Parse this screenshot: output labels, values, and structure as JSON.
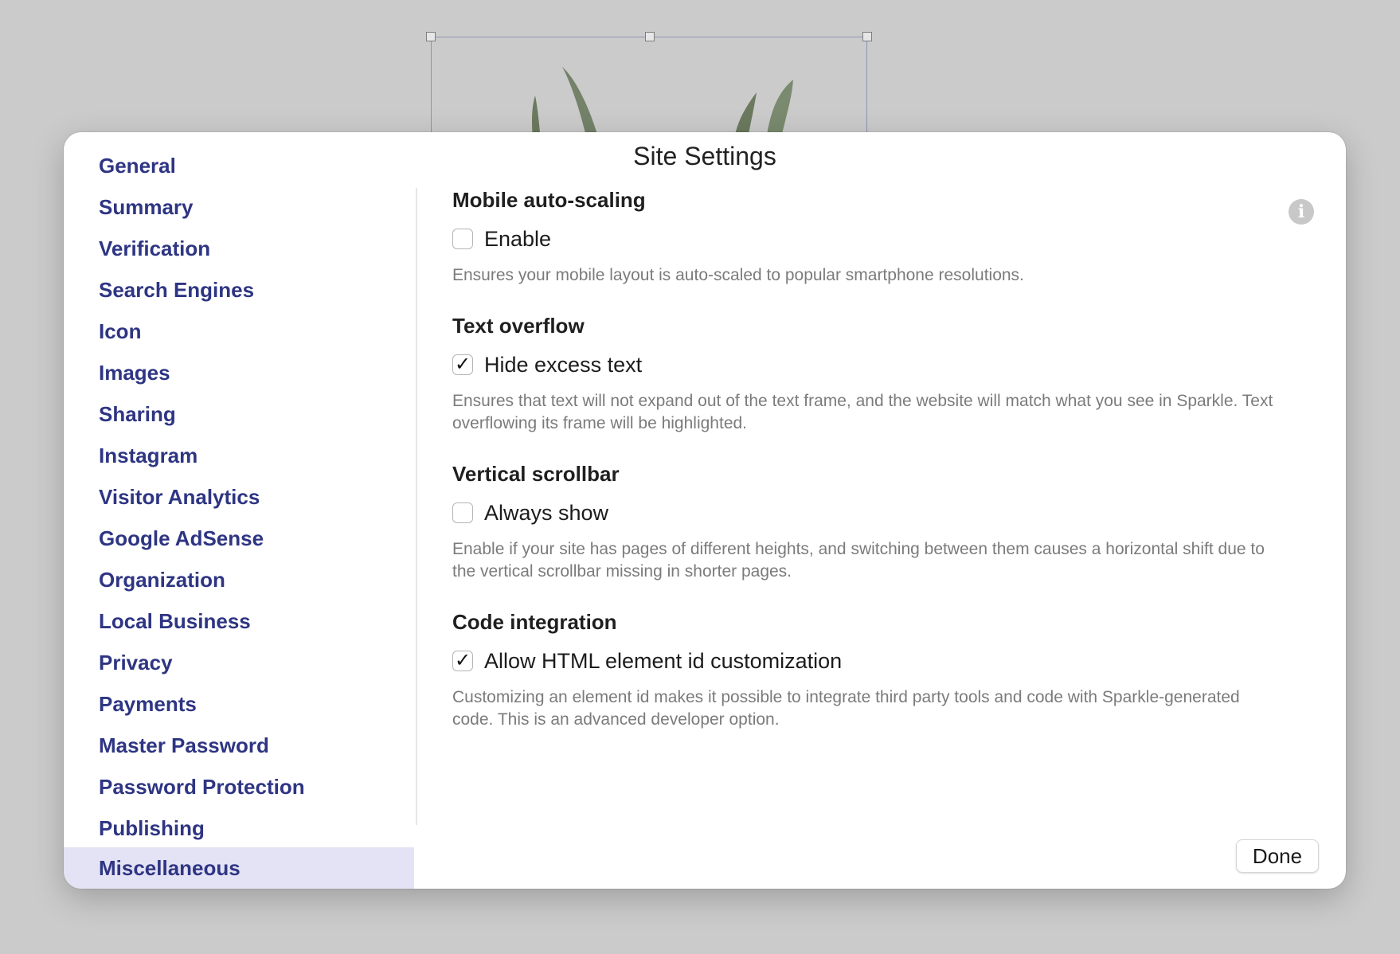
{
  "dialog": {
    "title": "Site Settings"
  },
  "sidebar": {
    "selected_index": 17,
    "items": [
      {
        "label": "General"
      },
      {
        "label": "Summary"
      },
      {
        "label": "Verification"
      },
      {
        "label": "Search Engines"
      },
      {
        "label": "Icon"
      },
      {
        "label": "Images"
      },
      {
        "label": "Sharing"
      },
      {
        "label": "Instagram"
      },
      {
        "label": "Visitor Analytics"
      },
      {
        "label": "Google AdSense"
      },
      {
        "label": "Organization"
      },
      {
        "label": "Local Business"
      },
      {
        "label": "Privacy"
      },
      {
        "label": "Payments"
      },
      {
        "label": "Master Password"
      },
      {
        "label": "Password Protection"
      },
      {
        "label": "Publishing"
      },
      {
        "label": "Miscellaneous"
      }
    ]
  },
  "sections": [
    {
      "heading": "Mobile auto-scaling",
      "checkbox_label": "Enable",
      "checked": false,
      "description": "Ensures your mobile layout is auto-scaled to popular smartphone resolutions."
    },
    {
      "heading": "Text overflow",
      "checkbox_label": "Hide excess text",
      "checked": true,
      "description": "Ensures that text will not expand out of the text frame, and the website will match what you see in Sparkle. Text overflowing its frame will be highlighted."
    },
    {
      "heading": "Vertical scrollbar",
      "checkbox_label": "Always show",
      "checked": false,
      "description": "Enable if your site has pages of different heights, and switching between them causes a horizontal shift due to the vertical scrollbar missing in shorter pages."
    },
    {
      "heading": "Code integration",
      "checkbox_label": "Allow HTML element id customization",
      "checked": true,
      "description": "Customizing an element id makes it possible to integrate third party tools and code with Sparkle-generated code. This is an advanced developer option."
    }
  ],
  "check_glyph": "✓",
  "info_icon": {
    "icon": "info-icon",
    "glyph": "i"
  },
  "done_button": {
    "label": "Done"
  },
  "colors": {
    "sidebar_text": "#2e3583",
    "sidebar_selected_bg": "#e4e2f5",
    "description_text": "#7b7b7b",
    "background": "#cbcbcb"
  }
}
